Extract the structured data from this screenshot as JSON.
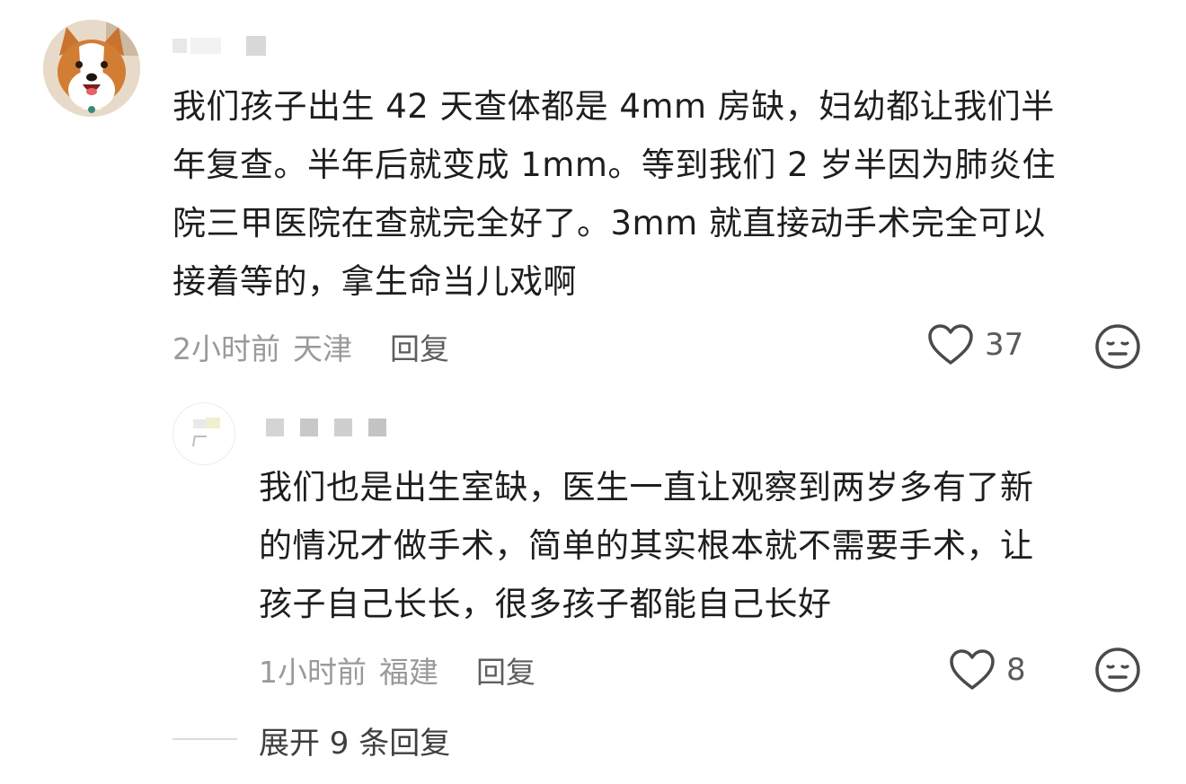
{
  "comment": {
    "avatar_icon": "corgi-avatar-icon",
    "username_colors": [
      "#e8e8e8",
      "#f2f2f2",
      "#d8d8d8"
    ],
    "text": "我们孩子出生 42 天查体都是 4mm 房缺，妇幼都让我们半\n年复查。半年后就变成 1mm。等到我们 2 岁半因为肺炎住\n院三甲医院在查就完全好了。3mm 就直接动手术完全可以\n接着等的，拿生命当儿戏啊",
    "time": "2小时前",
    "location": "天津",
    "reply_label": "回复",
    "likes": "37",
    "like_icon": "heart-outline-icon",
    "dislike_icon": "meh-face-icon"
  },
  "reply": {
    "avatar_icon": "blurred-avatar-icon",
    "username_colors": [
      "#d4d4d4",
      "#c8c8c8",
      "#cfcfcf",
      "#c4c4c4"
    ],
    "text": "我们也是出生室缺，医生一直让观察到两岁多有了新\n的情况才做手术，简单的其实根本就不需要手术，让\n孩子自己长长，很多孩子都能自己长好",
    "time": "1小时前",
    "location": "福建",
    "reply_label": "回复",
    "likes": "8",
    "like_icon": "heart-outline-icon",
    "dislike_icon": "meh-face-icon"
  },
  "expand": {
    "label": "展开 9 条回复"
  }
}
